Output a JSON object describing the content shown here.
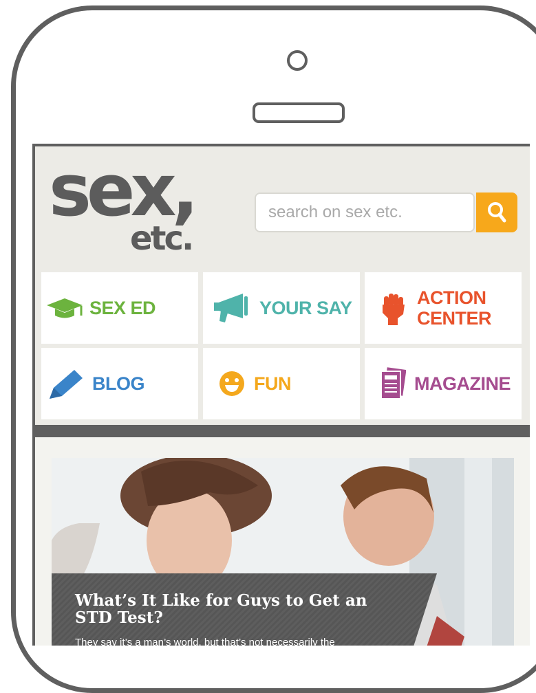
{
  "logo": {
    "main": "sex,",
    "sub": "etc."
  },
  "search": {
    "placeholder": "search on sex etc.",
    "icon": "search-icon"
  },
  "colors": {
    "sex_ed": "#6cb33e",
    "your_say": "#4fb3aa",
    "action_center": "#e8532c",
    "blog": "#3a84c9",
    "fun": "#f4a81d",
    "magazine": "#a54c8f",
    "search_button": "#f7a81b"
  },
  "nav": {
    "items": [
      {
        "label": "SEX ED",
        "icon": "graduation-cap-icon"
      },
      {
        "label": "YOUR SAY",
        "icon": "megaphone-icon"
      },
      {
        "label": "ACTION\nCENTER",
        "icon": "raised-fist-icon"
      },
      {
        "label": "BLOG",
        "icon": "pencil-icon"
      },
      {
        "label": "FUN",
        "icon": "smiley-face-icon"
      },
      {
        "label": "MAGAZINE",
        "icon": "magazine-icon"
      }
    ]
  },
  "feature": {
    "title": "What’s It Like for Guys to Get an STD Test?",
    "excerpt": "They say it’s a man’s world, but that’s not necessarily the"
  }
}
